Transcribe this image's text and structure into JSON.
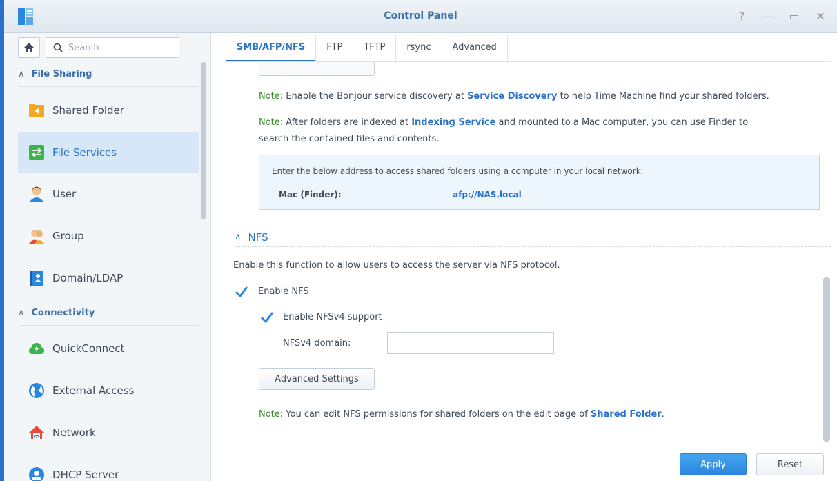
{
  "window": {
    "title": "Control Panel"
  },
  "sidebar": {
    "search_placeholder": "Search",
    "sections": [
      {
        "label": "File Sharing"
      },
      {
        "label": "Connectivity"
      }
    ],
    "items": [
      {
        "label": "Shared Folder"
      },
      {
        "label": "File Services"
      },
      {
        "label": "User"
      },
      {
        "label": "Group"
      },
      {
        "label": "Domain/LDAP"
      },
      {
        "label": "QuickConnect"
      },
      {
        "label": "External Access"
      },
      {
        "label": "Network"
      },
      {
        "label": "DHCP Server"
      }
    ]
  },
  "tabs": [
    {
      "label": "SMB/AFP/NFS"
    },
    {
      "label": "FTP"
    },
    {
      "label": "TFTP"
    },
    {
      "label": "rsync"
    },
    {
      "label": "Advanced"
    }
  ],
  "afp": {
    "note1": {
      "prefix": "Note:",
      "pre": " Enable the Bonjour service discovery at ",
      "link": "Service Discovery",
      "post": " to help Time Machine find your shared folders."
    },
    "note2": {
      "prefix": "Note:",
      "pre": " After folders are indexed at ",
      "link": "Indexing Service",
      "post": " and mounted to a Mac computer, you can use Finder to",
      "line2": "search the contained files and contents."
    },
    "address_box": {
      "description": "Enter the below address to access shared folders using a computer in your local network:",
      "key": "Mac (Finder):",
      "value": "afp://NAS.local"
    }
  },
  "nfs": {
    "title": "NFS",
    "description": "Enable this function to allow users to access the server via NFS protocol.",
    "enable_label": "Enable NFS",
    "enable_checked": true,
    "v4_label": "Enable NFSv4 support",
    "v4_checked": true,
    "domain_label": "NFSv4 domain:",
    "domain_value": "",
    "advanced_button": "Advanced Settings",
    "note": {
      "prefix": "Note:",
      "pre": " You can edit NFS permissions for shared folders on the edit page of ",
      "link": "Shared Folder",
      "post": "."
    }
  },
  "footer": {
    "apply": "Apply",
    "reset": "Reset"
  },
  "colors": {
    "accent": "#2a73c9",
    "note_label": "#3c8a2e",
    "active_item_bg": "#d6e8f7"
  }
}
